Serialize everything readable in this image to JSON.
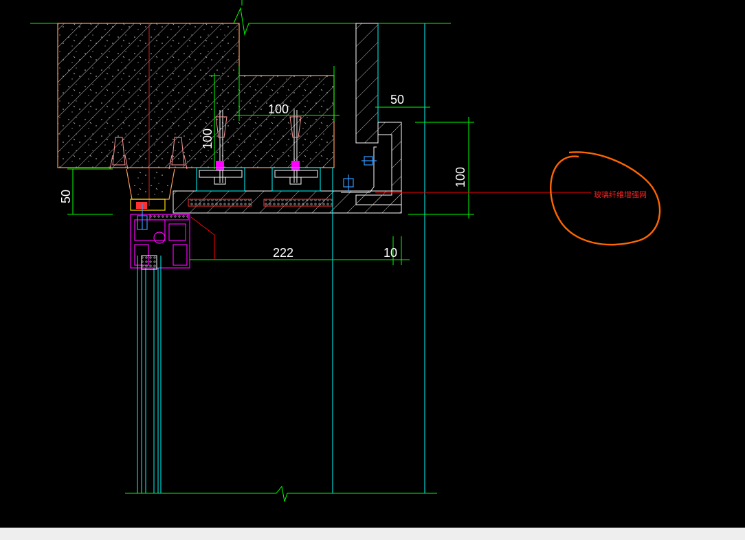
{
  "drawing": {
    "dimensions": [
      "100",
      "100",
      "50",
      "50",
      "100",
      "222",
      "10"
    ],
    "annotation": "玻璃纤维增强网"
  },
  "colors": {
    "background": "#000000",
    "dimension": "#00ff00",
    "centerline": "#00ffff",
    "concrete_outline": "#ff9955",
    "steel": "#ffffff",
    "anchor_bolt": "#ff00ff",
    "leader": "#ff0000",
    "highlight_circle": "#ff6600",
    "frame_profile": "#ff00ff",
    "glass": "#00ffff",
    "bracket": "#3399ff",
    "status_strip": "#eeeeee"
  }
}
